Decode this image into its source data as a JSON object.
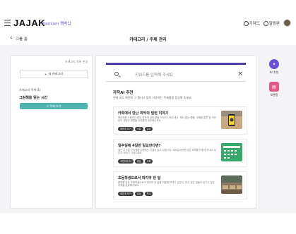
{
  "header": {
    "logo": "JAJAK",
    "premium_label": "Premium 멤버십",
    "guide_label": "가이드",
    "notice_label": "알림판"
  },
  "subheader": {
    "back_label": "그룹 홈",
    "title": "카테고리 / 주제 관리"
  },
  "left_panel": {
    "top_link": "카테고리 목록 변경",
    "add_category_label": "새 카테고리",
    "category_heading": "카테고리 목록(1)",
    "category_name": "그림책을 읽는 시간",
    "add_topic_label": "+ 주제 추가"
  },
  "main": {
    "search_placeholder": "키워드를 입력해 주세요",
    "ai_title": "자작AI 추천",
    "ai_subtitle": "현재 조도 화면의 그 필터시 많이 사랑하는 주제들을 동일해 추세요.",
    "cards": [
      {
        "title": "카톡에서 만난 최악의 빌런 이야기",
        "desc": "메신저를 사용하다 만난 최악의 상대 방을 이야기 나눠주세요. 매너 없는 행동, 무례한 말투 등 여러분이 겪었던 경험을 자유롭게 공유해주세요.",
        "tags": [
          "재밌게 보기",
          "소통",
          "일상"
        ]
      },
      {
        "title": "일주일에 4일만 일교한다면?",
        "desc": "최근 주 4일 근무제를 시행하는 기업이 늘고 있습니다. 여러분이라면 남은 하루를 어떻게 보내고 싶은지 이야기 나눠주세요.",
        "tags": [
          "고민하게 되",
          "일상",
          "사회"
        ]
      },
      {
        "title": "초등학생으로서 마지막 한 달",
        "desc": "졸업을 앞둔 초등학생으로서 마지막 한 달을 어떻게 보내고 싶은지, 하고 싶은 일들과 남기고 싶은 추억을 공유해주세요.",
        "tags": [
          "재밌게 보기",
          "일상",
          "학교"
        ]
      }
    ]
  },
  "right_rail": {
    "items": [
      {
        "label": "AI 추천",
        "icon": "ai-icon",
        "color": "#6b4fd8"
      },
      {
        "label": "보관함",
        "icon": "archive-icon",
        "color": "#e05a8a"
      }
    ]
  },
  "colors": {
    "accent": "#4b3fa8",
    "teal": "#4fb4ae",
    "premium": "#5b4fcf"
  }
}
